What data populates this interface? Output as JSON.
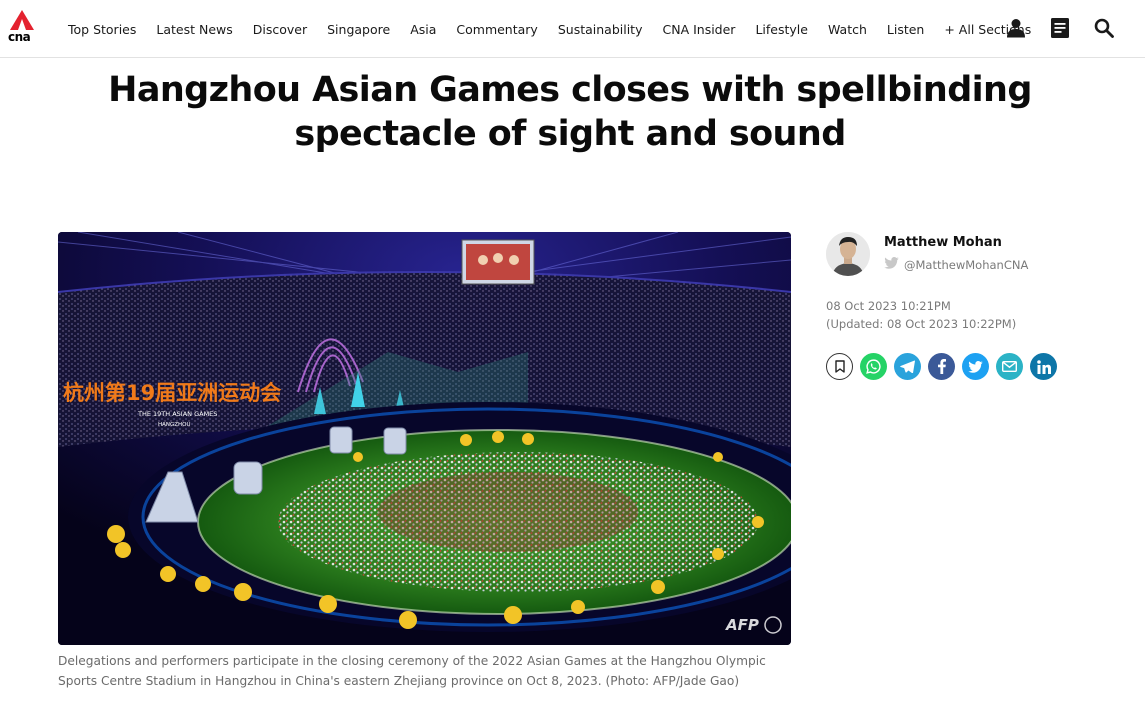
{
  "header": {
    "logo_text": "cna",
    "nav": [
      "Top Stories",
      "Latest News",
      "Discover",
      "Singapore",
      "Asia",
      "Commentary",
      "Sustainability",
      "CNA Insider",
      "Lifestyle",
      "Watch",
      "Listen",
      "+ All Sections"
    ]
  },
  "article": {
    "title_line1": "Hangzhou Asian Games closes with spellbinding",
    "title_line2": "spectacle of sight and sound",
    "image": {
      "sign_chinese": "杭州第19届亚洲运动会",
      "sign_english_1": "THE 19TH ASIAN GAMES",
      "sign_english_2": "HANGZHOU",
      "watermark": "AFP",
      "caption": "Delegations and performers participate in the closing ceremony of the 2022 Asian Games at the Hangzhou Olympic Sports Centre Stadium in Hangzhou in China's eastern Zhejiang province on Oct 8, 2023. (Photo: AFP/Jade Gao)"
    }
  },
  "author": {
    "name": "Matthew Mohan",
    "handle": "@MatthewMohanCNA"
  },
  "dates": {
    "published": "08 Oct 2023 10:21PM",
    "updated": "(Updated: 08 Oct 2023 10:22PM)"
  },
  "share_buttons": [
    {
      "name": "bookmark-icon",
      "color": "#ffffff"
    },
    {
      "name": "whatsapp-icon",
      "color": "#25d366"
    },
    {
      "name": "telegram-icon",
      "color": "#2aa3dc"
    },
    {
      "name": "facebook-icon",
      "color": "#3b5998"
    },
    {
      "name": "twitter-icon",
      "color": "#1da1f2"
    },
    {
      "name": "email-icon",
      "color": "#2bb3c6"
    },
    {
      "name": "linkedin-icon",
      "color": "#0e76a8"
    }
  ]
}
